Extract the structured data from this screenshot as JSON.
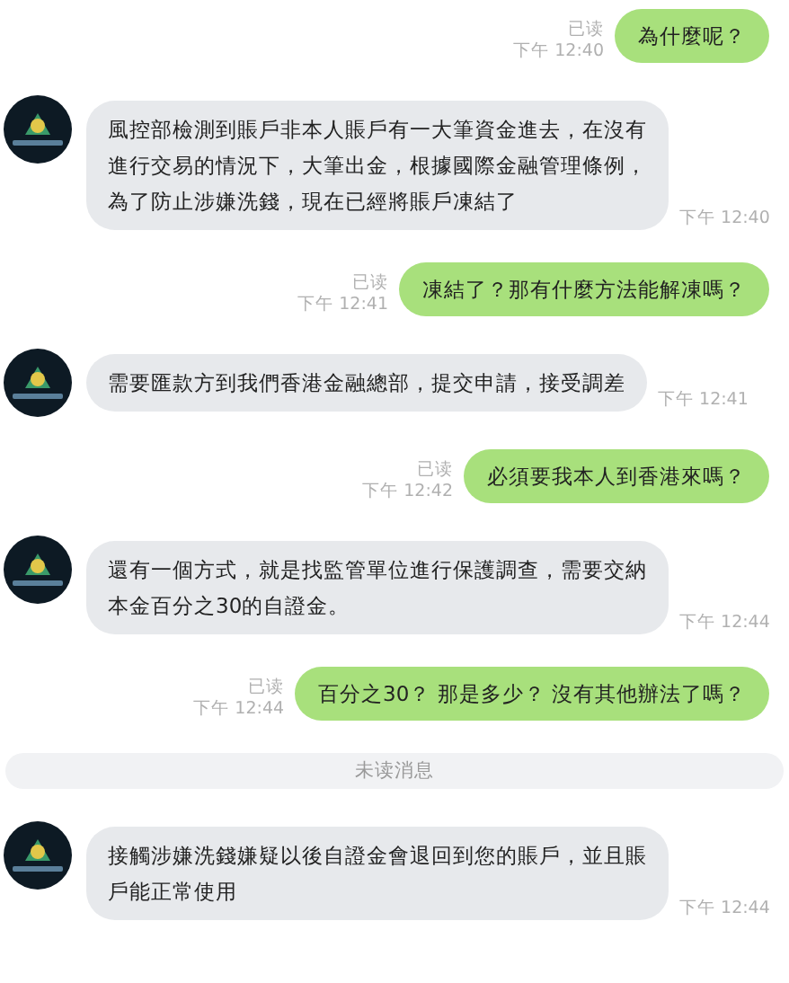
{
  "messages": [
    {
      "kind": "sent",
      "lines": [
        "為什麼呢？"
      ],
      "read_label": "已读",
      "time": "下午 12:40"
    },
    {
      "kind": "received",
      "lines": [
        "風控部檢測到賬戶非本人賬戶有一大筆資金進去，在沒有",
        "進行交易的情況下，大筆出金，根據國際金融管理條例，",
        "為了防止涉嫌洗錢，現在已經將賬戶凍結了"
      ],
      "time": "下午 12:40"
    },
    {
      "kind": "sent",
      "lines": [
        "凍結了？那有什麼方法能解凍嗎？"
      ],
      "read_label": "已读",
      "time": "下午 12:41"
    },
    {
      "kind": "received",
      "lines": [
        "需要匯款方到我們香港金融總部，提交申請，接受調差"
      ],
      "time": "下午 12:41"
    },
    {
      "kind": "sent",
      "lines": [
        "必須要我本人到香港來嗎？"
      ],
      "read_label": "已读",
      "time": "下午 12:42"
    },
    {
      "kind": "received",
      "lines": [
        "還有一個方式，就是找監管單位進行保護調查，需要交納",
        "本金百分之30的自證金。"
      ],
      "time": "下午 12:44"
    },
    {
      "kind": "sent",
      "lines": [
        "百分之30？ 那是多少？ 沒有其他辦法了嗎？"
      ],
      "read_label": "已读",
      "time": "下午 12:44"
    },
    {
      "kind": "divider",
      "label": "未读消息"
    },
    {
      "kind": "received",
      "lines": [
        "接觸涉嫌洗錢嫌疑以後自證金會退回到您的賬戶，並且賬",
        "戶能正常使用"
      ],
      "time": "下午 12:44"
    }
  ]
}
